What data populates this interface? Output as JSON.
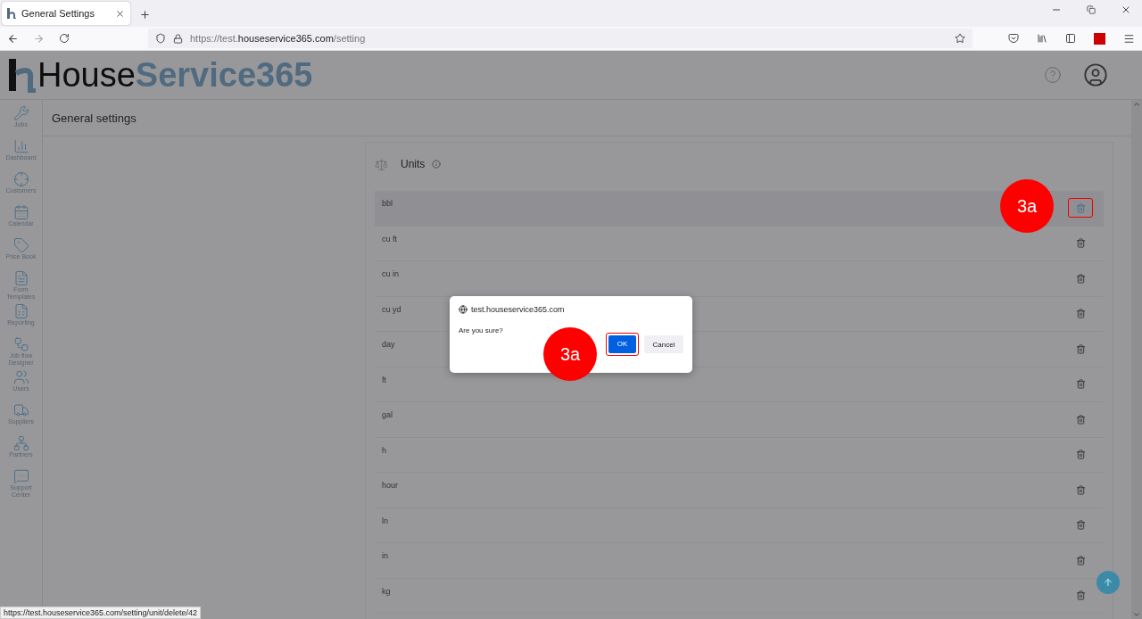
{
  "browser": {
    "tab": {
      "title": "General Settings",
      "selected": true
    },
    "url": {
      "prefix": "https://test.",
      "domain": "houseservice365.com",
      "path": "/setting"
    }
  },
  "app": {
    "logo": {
      "first": "House",
      "second": "Service365"
    }
  },
  "sidebar": {
    "items": [
      {
        "label": "Jobs"
      },
      {
        "label": "Dashboard"
      },
      {
        "label": "Customers"
      },
      {
        "label": "Calendar"
      },
      {
        "label": "Price Book"
      },
      {
        "label": "Form Templates"
      },
      {
        "label": "Reporting"
      },
      {
        "label": "Job flow Designer"
      },
      {
        "label": "Users"
      },
      {
        "label": "Suppliers"
      },
      {
        "label": "Partners"
      },
      {
        "label": "Support Center"
      }
    ]
  },
  "page": {
    "title": "General settings"
  },
  "units": {
    "title": "Units",
    "rows": [
      {
        "name": "bbl",
        "selected": true
      },
      {
        "name": "cu ft",
        "selected": false
      },
      {
        "name": "cu in",
        "selected": false
      },
      {
        "name": "cu yd",
        "selected": false
      },
      {
        "name": "day",
        "selected": false
      },
      {
        "name": "ft",
        "selected": false
      },
      {
        "name": "gal",
        "selected": false
      },
      {
        "name": "h",
        "selected": false
      },
      {
        "name": "hour",
        "selected": false
      },
      {
        "name": "ln",
        "selected": false
      },
      {
        "name": "in",
        "selected": false
      },
      {
        "name": "kg",
        "selected": false
      }
    ]
  },
  "dialog": {
    "origin": "test.houseservice365.com",
    "message": "Are you sure?",
    "ok": {
      "label": "OK",
      "outlined": true
    },
    "cancel": "Cancel"
  },
  "annotations": [
    {
      "label": "3a"
    },
    {
      "label": "3a"
    }
  ],
  "status_bar": "https://test.houseservice365.com/setting/unit/delete/42"
}
